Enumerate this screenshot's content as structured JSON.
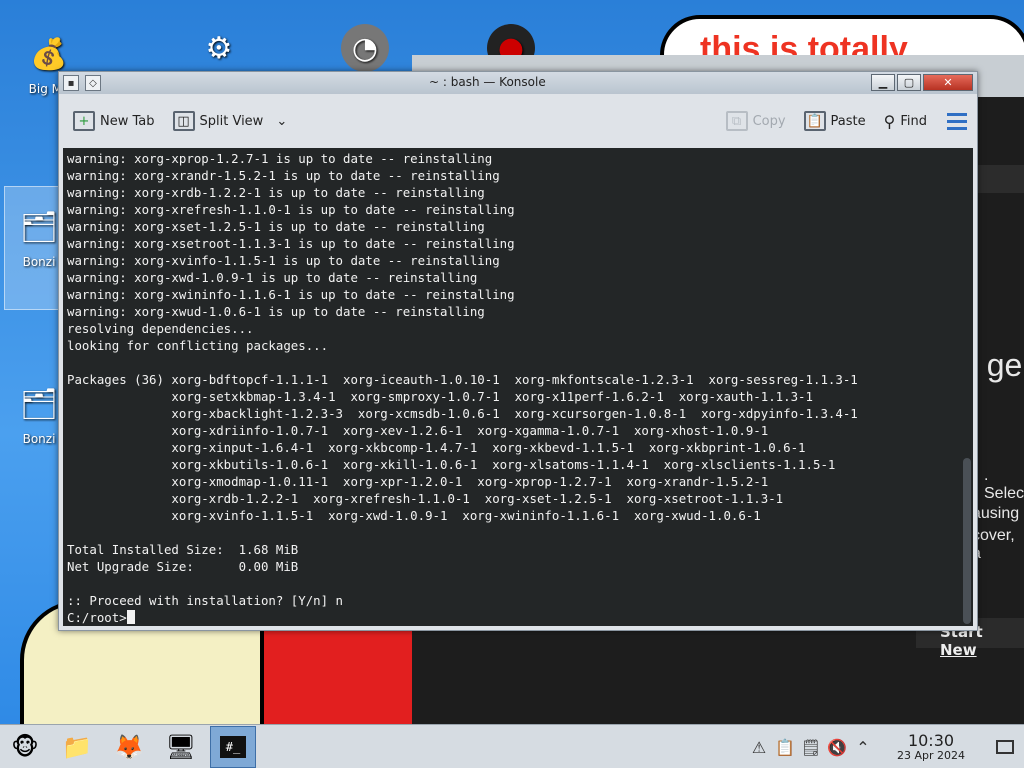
{
  "desktop": {
    "meme_text": "this is totally",
    "icons": [
      {
        "label": "Big Mo",
        "icon": "money-bag-icon"
      },
      {
        "label": "",
        "icon": "gear-icon"
      },
      {
        "label": "",
        "icon": "gauge-icon"
      },
      {
        "label": "",
        "icon": "red-circle-icon"
      },
      {
        "label": "Bonzi",
        "icon": "bonzi-installer-icon"
      },
      {
        "label": "Bonzi",
        "icon": "bonzi-installer-icon"
      }
    ],
    "background_window": {
      "text_fragments": [
        "e ge",
        ". Selec",
        "ausing",
        "cover, a"
      ],
      "start_new": {
        "prefix": "Start ",
        "emph": "New"
      }
    }
  },
  "konsole": {
    "title": "~ : bash — Konsole",
    "toolbar": {
      "new_tab": "New Tab",
      "split_view": "Split View",
      "copy": "Copy",
      "paste": "Paste",
      "find": "Find"
    },
    "terminal_lines": [
      "warning: xorg-xprop-1.2.7-1 is up to date -- reinstalling",
      "warning: xorg-xrandr-1.5.2-1 is up to date -- reinstalling",
      "warning: xorg-xrdb-1.2.2-1 is up to date -- reinstalling",
      "warning: xorg-xrefresh-1.1.0-1 is up to date -- reinstalling",
      "warning: xorg-xset-1.2.5-1 is up to date -- reinstalling",
      "warning: xorg-xsetroot-1.1.3-1 is up to date -- reinstalling",
      "warning: xorg-xvinfo-1.1.5-1 is up to date -- reinstalling",
      "warning: xorg-xwd-1.0.9-1 is up to date -- reinstalling",
      "warning: xorg-xwininfo-1.1.6-1 is up to date -- reinstalling",
      "warning: xorg-xwud-1.0.6-1 is up to date -- reinstalling",
      "resolving dependencies...",
      "looking for conflicting packages...",
      "",
      "Packages (36) xorg-bdftopcf-1.1.1-1  xorg-iceauth-1.0.10-1  xorg-mkfontscale-1.2.3-1  xorg-sessreg-1.1.3-1",
      "              xorg-setxkbmap-1.3.4-1  xorg-smproxy-1.0.7-1  xorg-x11perf-1.6.2-1  xorg-xauth-1.1.3-1",
      "              xorg-xbacklight-1.2.3-3  xorg-xcmsdb-1.0.6-1  xorg-xcursorgen-1.0.8-1  xorg-xdpyinfo-1.3.4-1",
      "              xorg-xdriinfo-1.0.7-1  xorg-xev-1.2.6-1  xorg-xgamma-1.0.7-1  xorg-xhost-1.0.9-1",
      "              xorg-xinput-1.6.4-1  xorg-xkbcomp-1.4.7-1  xorg-xkbevd-1.1.5-1  xorg-xkbprint-1.0.6-1",
      "              xorg-xkbutils-1.0.6-1  xorg-xkill-1.0.6-1  xorg-xlsatoms-1.1.4-1  xorg-xlsclients-1.1.5-1",
      "              xorg-xmodmap-1.0.11-1  xorg-xpr-1.2.0-1  xorg-xprop-1.2.7-1  xorg-xrandr-1.5.2-1",
      "              xorg-xrdb-1.2.2-1  xorg-xrefresh-1.1.0-1  xorg-xset-1.2.5-1  xorg-xsetroot-1.1.3-1",
      "              xorg-xvinfo-1.1.5-1  xorg-xwd-1.0.9-1  xorg-xwininfo-1.1.6-1  xorg-xwud-1.0.6-1",
      "",
      "Total Installed Size:  1.68 MiB",
      "Net Upgrade Size:      0.00 MiB",
      "",
      ":: Proceed with installation? [Y/n] n"
    ],
    "prompt": "C:/root>"
  },
  "taskbar": {
    "items": [
      {
        "name": "start-menu-bonzi",
        "icon": "bonzi-icon",
        "glyph": "🐵"
      },
      {
        "name": "file-manager",
        "icon": "folder-icon",
        "glyph": "📁"
      },
      {
        "name": "firefox",
        "icon": "firefox-icon",
        "glyph": "🦊"
      },
      {
        "name": "control-panel",
        "icon": "monitor-settings-icon",
        "glyph": "🖥"
      },
      {
        "name": "konsole",
        "icon": "terminal-icon",
        "glyph": "#_"
      }
    ],
    "clock": {
      "time": "10:30",
      "date": "23 Apr 2024"
    }
  }
}
